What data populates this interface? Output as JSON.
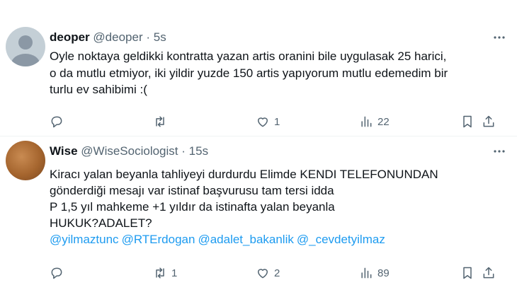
{
  "tweets": [
    {
      "name": "deoper",
      "handle": "@deoper",
      "separator": "·",
      "time": "5s",
      "lines": [
        "Oyle noktaya geldikki kontratta yazan artis oranini bile uygulasak 25 harici,",
        "o da mutlu etmiyor, iki yildir yuzde 150 artis yapıyorum mutlu edemedim bir",
        "turlu ev sahibimi :("
      ],
      "actions": {
        "reply": "",
        "retweet": "",
        "like": "1",
        "views": "22"
      }
    },
    {
      "name": "Wise",
      "handle": "@WiseSociologist",
      "separator": "·",
      "time": "15s",
      "lines": [
        "Kiracı yalan beyanla tahliyeyi durdurdu Elimde KENDI TELEFONUNDAN",
        "gönderdiği mesajı var istinaf başvurusu tam tersi idda",
        "P 1,5 yıl mahkeme +1 yıldır da istinafta yalan beyanla",
        "HUKUK?ADALET?"
      ],
      "mentions": [
        "@yilmaztunc",
        "@RTErdogan",
        "@adalet_bakanlik",
        "@_cevdetyilmaz"
      ],
      "actions": {
        "reply": "",
        "retweet": "1",
        "like": "2",
        "views": "89"
      }
    }
  ],
  "icons": [
    "reply-icon",
    "retweet-icon",
    "like-icon",
    "views-icon",
    "bookmark-icon",
    "share-icon",
    "more-icon"
  ],
  "colors": {
    "text": "#0f1419",
    "secondary": "#536471",
    "link": "#1d9bf0",
    "divider": "#eff3f4"
  }
}
